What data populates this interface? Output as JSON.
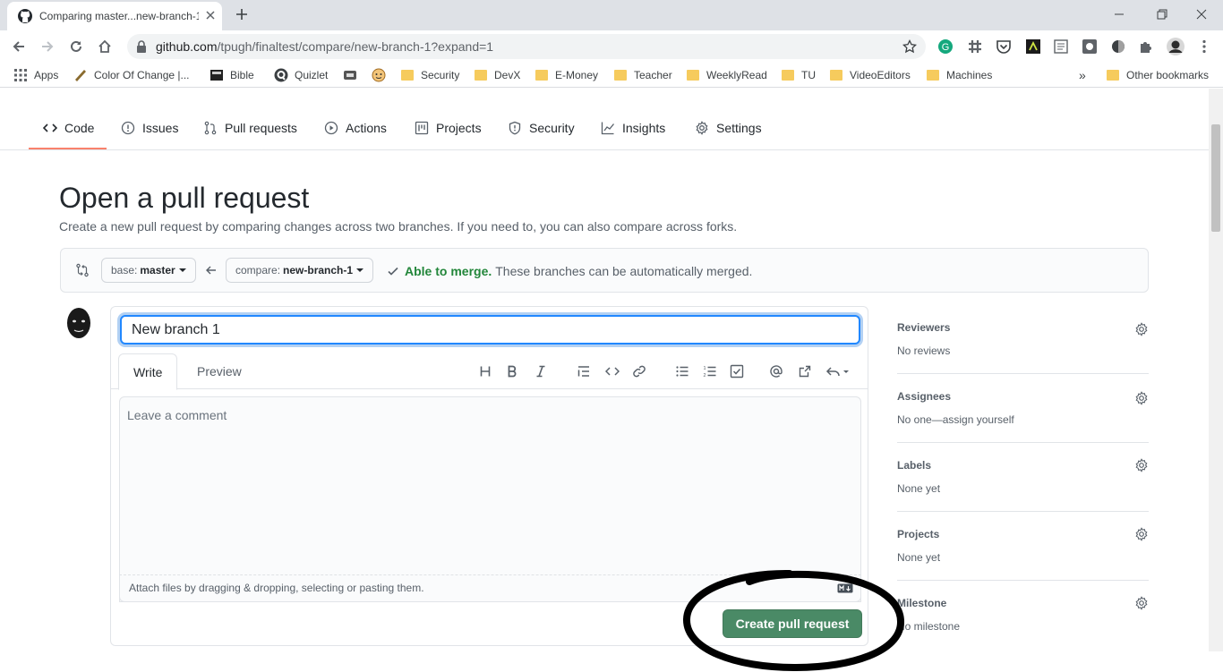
{
  "browser": {
    "tab_title": "Comparing master...new-branch-1",
    "url_host": "github.com",
    "url_path": "/tpugh/finaltest/compare/new-branch-1?expand=1",
    "bookmarks": [
      "Apps",
      "Color Of Change |...",
      "Bible",
      "Quizlet",
      "Security",
      "DevX",
      "E-Money",
      "Teacher",
      "WeeklyRead",
      "TU",
      "VideoEditors",
      "Machines"
    ],
    "more_bookmarks": "»",
    "other_bookmarks": "Other bookmarks"
  },
  "repo_nav": [
    {
      "label": "Code",
      "icon": "code-icon"
    },
    {
      "label": "Issues",
      "icon": "issue-icon"
    },
    {
      "label": "Pull requests",
      "icon": "pull-request-icon"
    },
    {
      "label": "Actions",
      "icon": "play-icon"
    },
    {
      "label": "Projects",
      "icon": "project-icon"
    },
    {
      "label": "Security",
      "icon": "shield-icon"
    },
    {
      "label": "Insights",
      "icon": "graph-icon"
    },
    {
      "label": "Settings",
      "icon": "gear-icon"
    }
  ],
  "header": {
    "title": "Open a pull request",
    "subtitle": "Create a new pull request by comparing changes across two branches. If you need to, you can also compare across forks."
  },
  "range": {
    "base_prefix": "base:",
    "base_branch": "master",
    "compare_prefix": "compare:",
    "compare_branch": "new-branch-1",
    "merge_status": "Able to merge.",
    "merge_message": "These branches can be automatically merged."
  },
  "composer": {
    "title_value": "New branch 1",
    "tab_write": "Write",
    "tab_preview": "Preview",
    "comment_placeholder": "Leave a comment",
    "attach_hint": "Attach files by dragging & dropping, selecting or pasting them.",
    "submit_label": "Create pull request"
  },
  "sidebar": [
    {
      "heading": "Reviewers",
      "value": "No reviews"
    },
    {
      "heading": "Assignees",
      "value": "No one—assign yourself"
    },
    {
      "heading": "Labels",
      "value": "None yet"
    },
    {
      "heading": "Projects",
      "value": "None yet"
    },
    {
      "heading": "Milestone",
      "value": "No milestone"
    }
  ],
  "colors": {
    "accent_underline": "#f9826c",
    "success": "#22863a",
    "button": "#4a8a66",
    "annotation": "#000000"
  }
}
